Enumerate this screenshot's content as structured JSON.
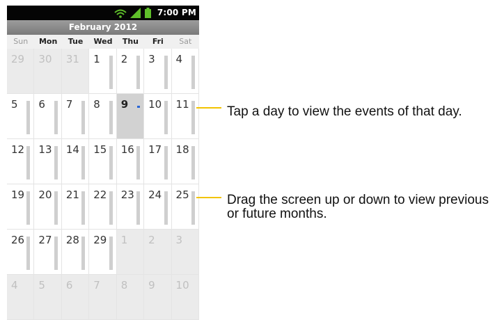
{
  "status_bar": {
    "time": "7:00 PM",
    "icons": [
      "wifi-icon",
      "signal-icon",
      "battery-icon"
    ]
  },
  "calendar": {
    "month_title": "February 2012",
    "weekdays": [
      "Sun",
      "Mon",
      "Tue",
      "Wed",
      "Thu",
      "Fri",
      "Sat"
    ],
    "today": "9",
    "weeks": [
      [
        {
          "d": "29",
          "out": true
        },
        {
          "d": "30",
          "out": true
        },
        {
          "d": "31",
          "out": true
        },
        {
          "d": "1"
        },
        {
          "d": "2"
        },
        {
          "d": "3"
        },
        {
          "d": "4"
        }
      ],
      [
        {
          "d": "5"
        },
        {
          "d": "6"
        },
        {
          "d": "7"
        },
        {
          "d": "8"
        },
        {
          "d": "9",
          "today": true,
          "event": true
        },
        {
          "d": "10"
        },
        {
          "d": "11"
        }
      ],
      [
        {
          "d": "12"
        },
        {
          "d": "13"
        },
        {
          "d": "14"
        },
        {
          "d": "15"
        },
        {
          "d": "16"
        },
        {
          "d": "17"
        },
        {
          "d": "18"
        }
      ],
      [
        {
          "d": "19"
        },
        {
          "d": "20"
        },
        {
          "d": "21"
        },
        {
          "d": "22"
        },
        {
          "d": "23"
        },
        {
          "d": "24"
        },
        {
          "d": "25"
        }
      ],
      [
        {
          "d": "26"
        },
        {
          "d": "27"
        },
        {
          "d": "28"
        },
        {
          "d": "29"
        },
        {
          "d": "1",
          "out": true
        },
        {
          "d": "2",
          "out": true
        },
        {
          "d": "3",
          "out": true
        }
      ],
      [
        {
          "d": "4",
          "out": true
        },
        {
          "d": "5",
          "out": true
        },
        {
          "d": "6",
          "out": true
        },
        {
          "d": "7",
          "out": true
        },
        {
          "d": "8",
          "out": true
        },
        {
          "d": "9",
          "out": true
        },
        {
          "d": "10",
          "out": true
        }
      ]
    ]
  },
  "callouts": {
    "tap_day": "Tap a day to view the events of that day.",
    "drag_screen": "Drag the screen up or down to view previous or future months."
  },
  "colors": {
    "callout_line": "#f2c300",
    "event_marker": "#2a66d6",
    "status_bar": "#050505"
  }
}
